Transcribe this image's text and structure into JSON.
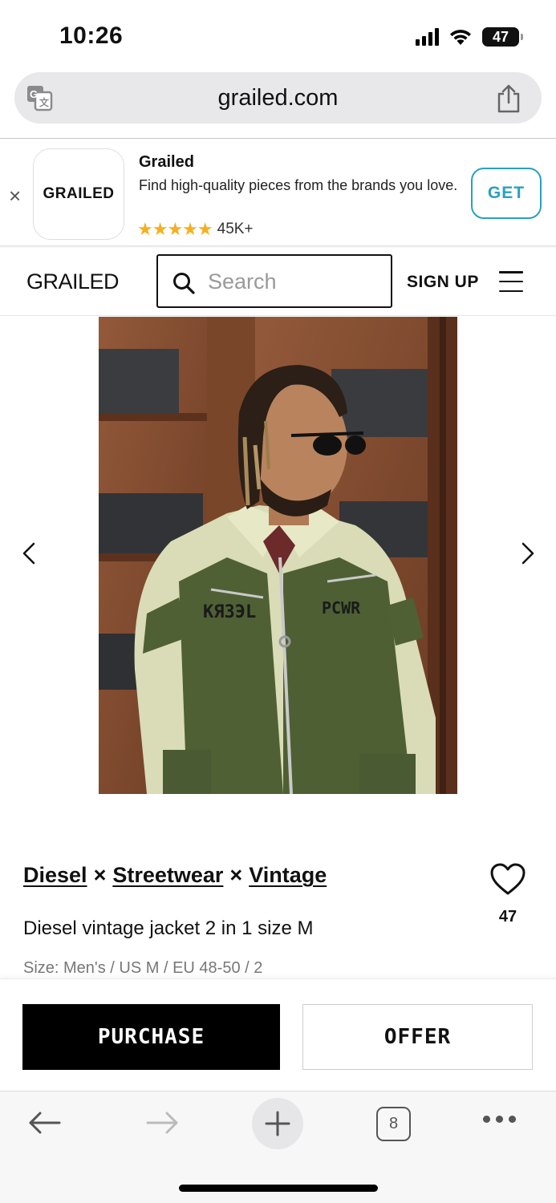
{
  "status_bar": {
    "time": "10:26",
    "battery": "47"
  },
  "browser": {
    "url": "grailed.com",
    "open_tabs": "8"
  },
  "app_banner": {
    "logo_text": "GRAILED",
    "title": "Grailed",
    "description": "Find high-quality pieces from the brands you love.",
    "stars": "★★★★★",
    "rating_count": "45K+",
    "get_label": "GET",
    "close_glyph": "×",
    "star_color": "#f6b01e",
    "accent_color": "#2aa0c2"
  },
  "header": {
    "logo": "GRAILED",
    "search_placeholder": "Search",
    "signup_label": "SIGN UP"
  },
  "product": {
    "designers": [
      "Diesel",
      "Streetwear",
      "Vintage"
    ],
    "designer_separator": "×",
    "title": "Diesel vintage jacket 2 in 1 size M",
    "size_info": "Size: Men's / US M / EU 48-50 / 2",
    "likes": "47",
    "jacket_print_left": "KЯЗЭL",
    "jacket_print_right": "PCWR"
  },
  "actions": {
    "purchase_label": "PURCHASE",
    "offer_label": "OFFER"
  }
}
